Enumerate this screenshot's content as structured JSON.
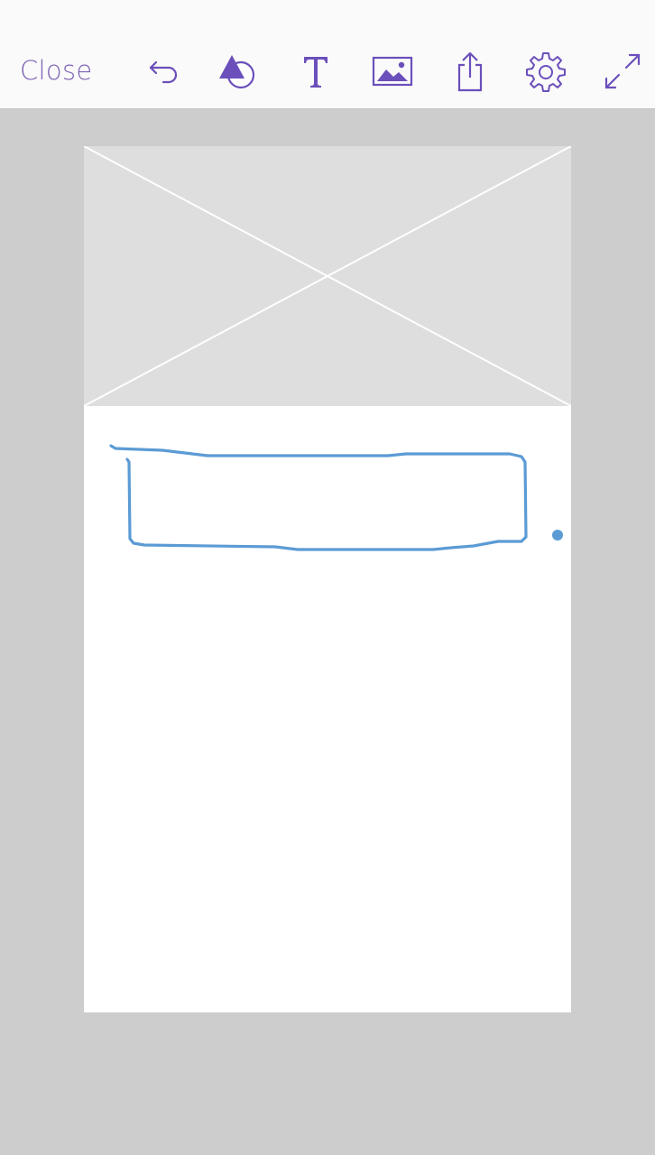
{
  "toolbar": {
    "close_label": "Close",
    "tools": [
      {
        "name": "undo-icon"
      },
      {
        "name": "shapes-icon"
      },
      {
        "name": "text-icon"
      },
      {
        "name": "image-icon"
      },
      {
        "name": "share-icon"
      },
      {
        "name": "settings-icon"
      },
      {
        "name": "fullscreen-icon"
      }
    ]
  },
  "colors": {
    "accent": "#6b4fbb",
    "accent_light": "#7c62b4",
    "toolbar_bg": "#fafafa",
    "workspace_bg": "#cdcdcd",
    "artboard_bg": "#ffffff",
    "placeholder_bg": "#dedede",
    "ink": "#5b9bd5"
  },
  "artboard": {
    "placeholder_name": "image-placeholder",
    "sketch_name": "hand-drawn-rectangle"
  }
}
